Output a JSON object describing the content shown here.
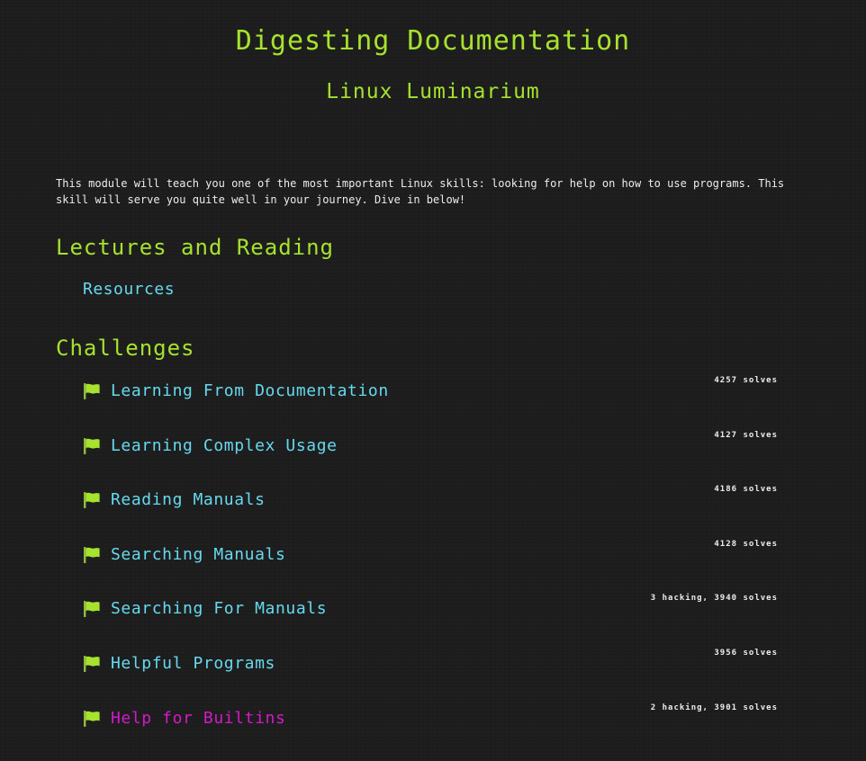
{
  "header": {
    "module_title": "Digesting Documentation",
    "dojo_title": "Linux Luminarium"
  },
  "description": "This module will teach you one of the most important Linux skills: looking for help on how to use programs. This skill will serve you quite well in your journey. Dive in below!",
  "lectures": {
    "heading": "Lectures and Reading",
    "items": [
      {
        "label": "Resources"
      }
    ]
  },
  "challenges": {
    "heading": "Challenges",
    "flag_icon": "flag-icon",
    "colors": {
      "flag": "#a6e22e",
      "name": "#66d9ef",
      "active_name": "#d519c9"
    },
    "items": [
      {
        "name": "Learning From Documentation",
        "stats": "4257 solves"
      },
      {
        "name": "Learning Complex Usage",
        "stats": "4127 solves"
      },
      {
        "name": "Reading Manuals",
        "stats": "4186 solves"
      },
      {
        "name": "Searching Manuals",
        "stats": "4128 solves"
      },
      {
        "name": "Searching For Manuals",
        "stats": "3 hacking, 3940 solves"
      },
      {
        "name": "Helpful Programs",
        "stats": "3956 solves"
      },
      {
        "name": "Help for Builtins",
        "stats": "2 hacking, 3901 solves"
      }
    ]
  }
}
